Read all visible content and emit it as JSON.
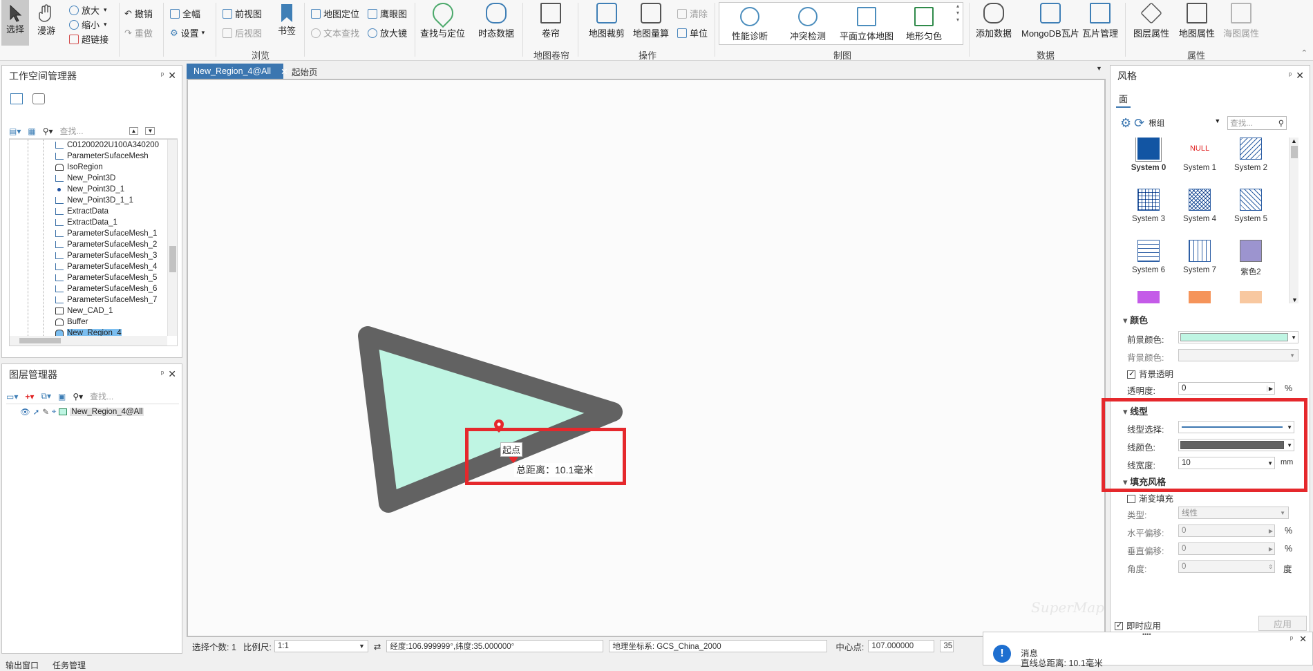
{
  "ribbon": {
    "select": "选择",
    "pan": "漫游",
    "zoom_in": "放大",
    "zoom_out": "缩小",
    "hyperlink": "超链接",
    "undo": "撤销",
    "redo": "重做",
    "full_extent": "全幅",
    "settings": "设置",
    "prev_view": "前视图",
    "next_view": "后视图",
    "bookmark": "书签",
    "map_locate": "地图定位",
    "text_find": "文本查找",
    "eagle_eye": "鹰眼图",
    "magnifier": "放大镜",
    "find_locate": "查找与定位",
    "temporal": "时态数据",
    "browse_group": "浏览",
    "swipe": "卷帘",
    "swipe_group": "地图卷帘",
    "map_clip": "地图裁剪",
    "map_measure": "地图量算",
    "clear": "清除",
    "unit": "单位",
    "operate_group": "操作",
    "gallery": [
      "性能诊断",
      "冲突检测",
      "平面立体地图",
      "地形匀色"
    ],
    "draw_group": "制图",
    "add_data": "添加数据",
    "mongodb_tiles": "MongoDB瓦片",
    "tile_manage": "瓦片管理",
    "data_group": "数据",
    "layer_props": "图层属性",
    "map_props": "地图属性",
    "scene_layer_props": "海图属性",
    "props_group": "属性"
  },
  "workspace": {
    "title": "工作空间管理器",
    "search_placeholder": "查找...",
    "items": [
      "C01200202U100A340200",
      "ParameterSufaceMesh",
      "IsoRegion",
      "New_Point3D",
      "New_Point3D_1",
      "New_Point3D_1_1",
      "ExtractData",
      "ExtractData_1",
      "ParameterSufaceMesh_1",
      "ParameterSufaceMesh_2",
      "ParameterSufaceMesh_3",
      "ParameterSufaceMesh_4",
      "ParameterSufaceMesh_5",
      "ParameterSufaceMesh_6",
      "ParameterSufaceMesh_7",
      "New_CAD_1",
      "Buffer",
      "New_Region_4"
    ]
  },
  "layers": {
    "title": "图层管理器",
    "search_placeholder": "查找...",
    "layer": "New_Region_4@All"
  },
  "tabs": {
    "active": "New_Region_4@All",
    "start": "起始页"
  },
  "map": {
    "start_label": "起点",
    "total_distance": "总距离：10.1毫米",
    "fill_color": "#bff5e3",
    "stroke_color": "#626262"
  },
  "status": {
    "selected_count": "选择个数: 1",
    "scale_label": "比例尺:",
    "scale_value": "1:1",
    "coords": "经度:106.999999°,纬度:35.000000°",
    "crs": "地理坐标系: GCS_China_2000",
    "center_label": "中心点:",
    "center_value": "107.000000",
    "center_value2": "35"
  },
  "bottom_tabs": [
    "输出窗口",
    "任务管理"
  ],
  "style": {
    "title": "风格",
    "tab_face": "面",
    "group_label": "根组",
    "search_placeholder": "查找...",
    "swatches": [
      {
        "label": "System 0",
        "kind": "solid",
        "color": "#1255a3"
      },
      {
        "label": "System 1",
        "kind": "null"
      },
      {
        "label": "System 2",
        "kind": "diag"
      },
      {
        "label": "System 3",
        "kind": "grid"
      },
      {
        "label": "System 4",
        "kind": "cross"
      },
      {
        "label": "System 5",
        "kind": "diag2"
      },
      {
        "label": "System 6",
        "kind": "hlines"
      },
      {
        "label": "System 7",
        "kind": "vlines"
      },
      {
        "label": "紫色2",
        "kind": "solid",
        "color": "#9c94cf"
      }
    ],
    "null_text": "NULL",
    "color_section": "颜色",
    "fg_label": "前景颜色:",
    "fg_color": "#bff5e3",
    "bg_label": "背景颜色:",
    "bg_transparent": "背景透明",
    "opacity_label": "透明度:",
    "opacity_value": "0",
    "percent": "%",
    "line_section": "线型",
    "line_select_label": "线型选择:",
    "line_color_label": "线颜色:",
    "line_color": "#626262",
    "line_width_label": "线宽度:",
    "line_width_value": "10",
    "mm": "mm",
    "fill_section": "填充风格",
    "gradient": "渐变填充",
    "type_label": "类型:",
    "type_value": "线性",
    "hoffset_label": "水平偏移:",
    "hoffset_value": "0",
    "voffset_label": "垂直偏移:",
    "voffset_value": "0",
    "angle_label": "角度:",
    "angle_value": "0",
    "degree": "度",
    "live_apply": "即时应用",
    "apply": "应用"
  },
  "message": {
    "title": "消息",
    "body": "直线总距离: 10.1毫米"
  },
  "watermark": "SuperMap"
}
